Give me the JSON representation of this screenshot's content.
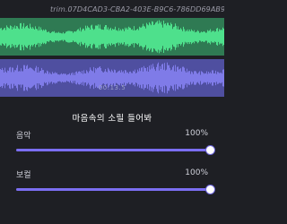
{
  "file": {
    "name": "trim.07D4CAD3-CBA2-403E-B9C6-786DD69AB9B0.M4A"
  },
  "timeline": {
    "time": "00:13.5"
  },
  "mixer": {
    "title": "마음속의 소릴 들어봐",
    "music": {
      "label": "음악",
      "value_text": "100%",
      "level": 1.0
    },
    "vocal": {
      "label": "보컬",
      "value_text": "100%",
      "level": 1.0
    }
  },
  "colors": {
    "background": "#1e1f24",
    "wave_top": "#4ee08c",
    "wave_top_bg": "#2f7a53",
    "wave_bottom": "#7f7be8",
    "wave_bottom_bg": "#4f4fa0",
    "slider_accent": "#7b6ef2"
  }
}
